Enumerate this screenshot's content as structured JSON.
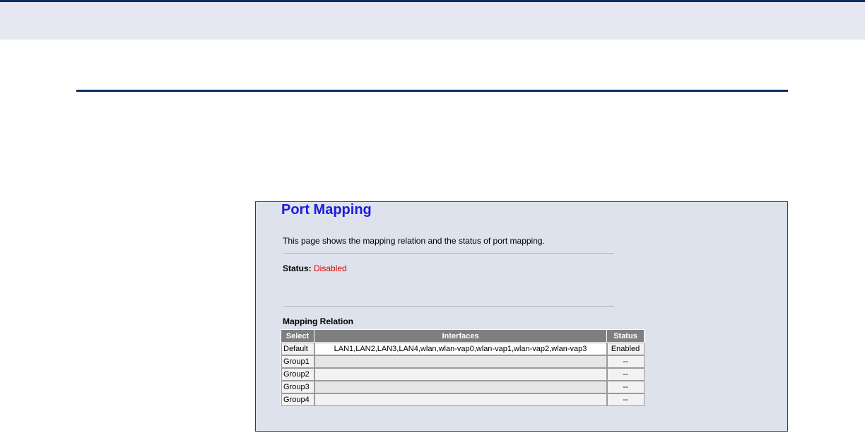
{
  "page": {
    "title": "Port Mapping",
    "description": "This page shows the mapping relation and the status of port mapping.",
    "status_label": "Status:",
    "status_value": "Disabled",
    "section_title": "Mapping Relation"
  },
  "table": {
    "headers": [
      "Select",
      "Interfaces",
      "Status"
    ],
    "rows": [
      {
        "select": "Default",
        "interfaces": "LAN1,LAN2,LAN3,LAN4,wlan,wlan-vap0,wlan-vap1,wlan-vap2,wlan-vap3",
        "status": "Enabled"
      },
      {
        "select": "Group1",
        "interfaces": "",
        "status": "--"
      },
      {
        "select": "Group2",
        "interfaces": "",
        "status": "--"
      },
      {
        "select": "Group3",
        "interfaces": "",
        "status": "--"
      },
      {
        "select": "Group4",
        "interfaces": "",
        "status": "--"
      }
    ]
  },
  "colors": {
    "title": "#1a1ae0",
    "status_disabled": "#e00000",
    "header_rule": "#0f2e5e",
    "panel_bg": "#dde2ec"
  }
}
